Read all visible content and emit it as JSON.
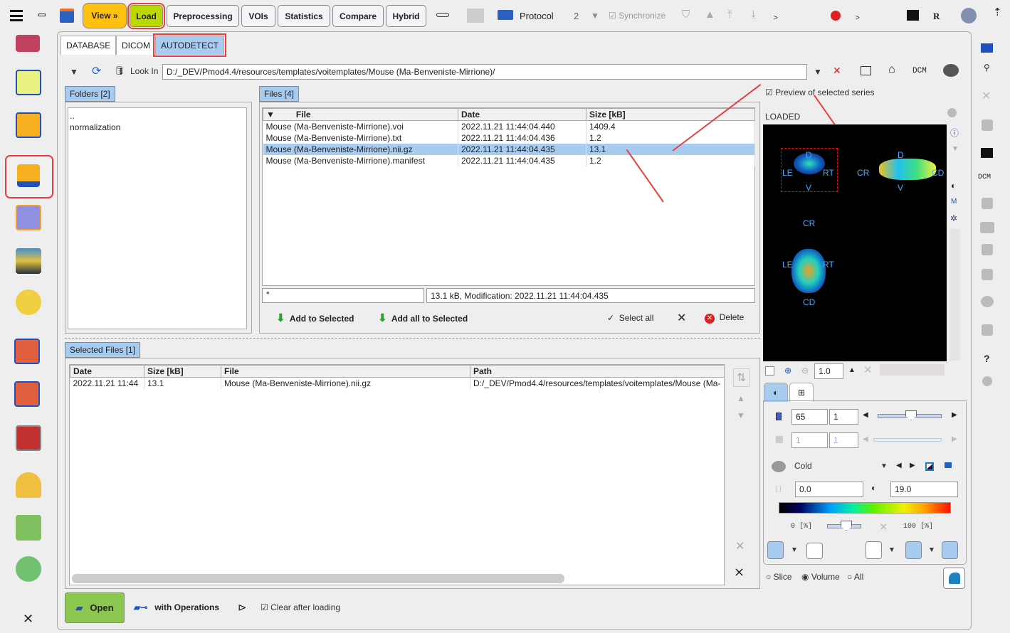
{
  "toolbar": {
    "view": "View »",
    "load": "Load",
    "preprocessing": "Preprocessing",
    "vois": "VOIs",
    "statistics": "Statistics",
    "compare": "Compare",
    "hybrid": "Hybrid",
    "protocol": "Protocol",
    "count": "2",
    "synchronize": "Synchronize",
    "r": "R",
    "arrows1": ">",
    "arrows2": ">"
  },
  "tabs": [
    "DATABASE",
    "DICOM",
    "AUTODETECT"
  ],
  "lookin": {
    "label": "Look In",
    "path": "D:/_DEV/Pmod4.4/resources/templates/voitemplates/Mouse (Ma-Benveniste-Mirrione)/",
    "dcm": "DCM"
  },
  "folders": {
    "title": "Folders [2]",
    "items": [
      "..",
      "normalization"
    ]
  },
  "files": {
    "title": "Files [4]",
    "columns": [
      "File",
      "Date",
      "Size [kB]"
    ],
    "rows": [
      [
        "Mouse (Ma-Benveniste-Mirrione).voi",
        "2022.11.21 11:44:04.440",
        "1409.4"
      ],
      [
        "Mouse (Ma-Benveniste-Mirrione).txt",
        "2022.11.21 11:44:04.436",
        "1.2"
      ],
      [
        "Mouse (Ma-Benveniste-Mirrione).nii.gz",
        "2022.11.21 11:44:04.435",
        "13.1"
      ],
      [
        "Mouse (Ma-Benveniste-Mirrione).manifest",
        "2022.11.21 11:44:04.435",
        "1.2"
      ]
    ],
    "filter": "*",
    "info": "13.1 kB,  Modification: 2022.11.21 11:44:04.435",
    "add_selected": "Add to Selected",
    "add_all": "Add all to Selected",
    "select_all": "Select all",
    "delete": "Delete"
  },
  "selected": {
    "title": "Selected Files [1]",
    "columns": [
      "Date",
      "Size [kB]",
      "File",
      "Path"
    ],
    "rows": [
      [
        "2022.11.21 11:44",
        "13.1",
        "Mouse (Ma-Benveniste-Mirrione).nii.gz",
        "D:/_DEV/Pmod4.4/resources/templates/voitemplates/Mouse (Ma-"
      ]
    ]
  },
  "bottom": {
    "open": "Open",
    "with_ops": "with Operations",
    "clear": "Clear after loading"
  },
  "preview": {
    "checkbox": "Preview of selected series",
    "status": "LOADED",
    "labels": {
      "d": "D",
      "v": "V",
      "le": "LE",
      "rt": "RT",
      "cr": "CR",
      "cd": "CD"
    },
    "zoom": "1.0",
    "slice": "65",
    "frame": "1",
    "frame2": "1",
    "frame3": "1",
    "colormap": "Cold",
    "min": "0.0",
    "max": "19.0",
    "pct_min": "0  [%]",
    "pct_max": "100  [%]",
    "modes": [
      "Slice",
      "Volume",
      "All"
    ],
    "selected_mode": "Volume",
    "dcm": "DCM",
    "help": "?"
  }
}
